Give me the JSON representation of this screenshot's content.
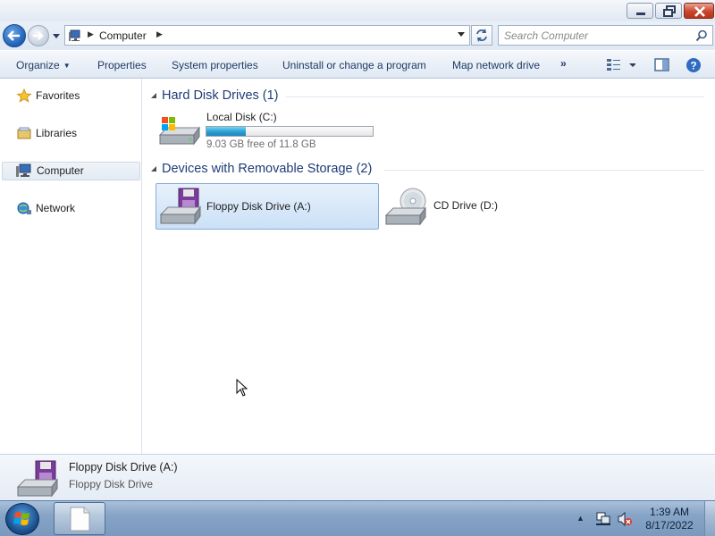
{
  "window": {
    "buttons": [
      "minimize-icon",
      "maximize-icon",
      "close-icon"
    ]
  },
  "address_bar": {
    "breadcrumb": "Computer",
    "search_placeholder": "Search Computer"
  },
  "toolbar": {
    "organize": "Organize",
    "properties": "Properties",
    "system_properties": "System properties",
    "uninstall": "Uninstall or change a program",
    "map_network_drive": "Map network drive",
    "overflow": "»"
  },
  "nav_pane": {
    "items": [
      {
        "label": "Favorites",
        "icon": "star-icon"
      },
      {
        "label": "Libraries",
        "icon": "libraries-icon"
      },
      {
        "label": "Computer",
        "icon": "computer-icon",
        "selected": true
      },
      {
        "label": "Network",
        "icon": "network-icon"
      }
    ]
  },
  "content": {
    "groups": [
      {
        "title": "Hard Disk Drives (1)",
        "items": [
          {
            "name": "Local Disk (C:)",
            "free_text": "9.03 GB free of 11.8 GB",
            "used_fraction": 0.235,
            "icon": "hard-disk-icon"
          }
        ]
      },
      {
        "title": "Devices with Removable Storage (2)",
        "items": [
          {
            "name": "Floppy Disk Drive (A:)",
            "icon": "floppy-drive-icon",
            "selected": true
          },
          {
            "name": "CD Drive (D:)",
            "icon": "cd-drive-icon"
          }
        ]
      }
    ]
  },
  "details": {
    "name": "Floppy Disk Drive (A:)",
    "type": "Floppy Disk Drive"
  },
  "taskbar": {
    "time": "1:39 AM",
    "date": "8/17/2022"
  },
  "colors": {
    "accent": "#1e3c78",
    "capacity_bar": "#2ba3d6",
    "selection": "#cbe0f6"
  }
}
